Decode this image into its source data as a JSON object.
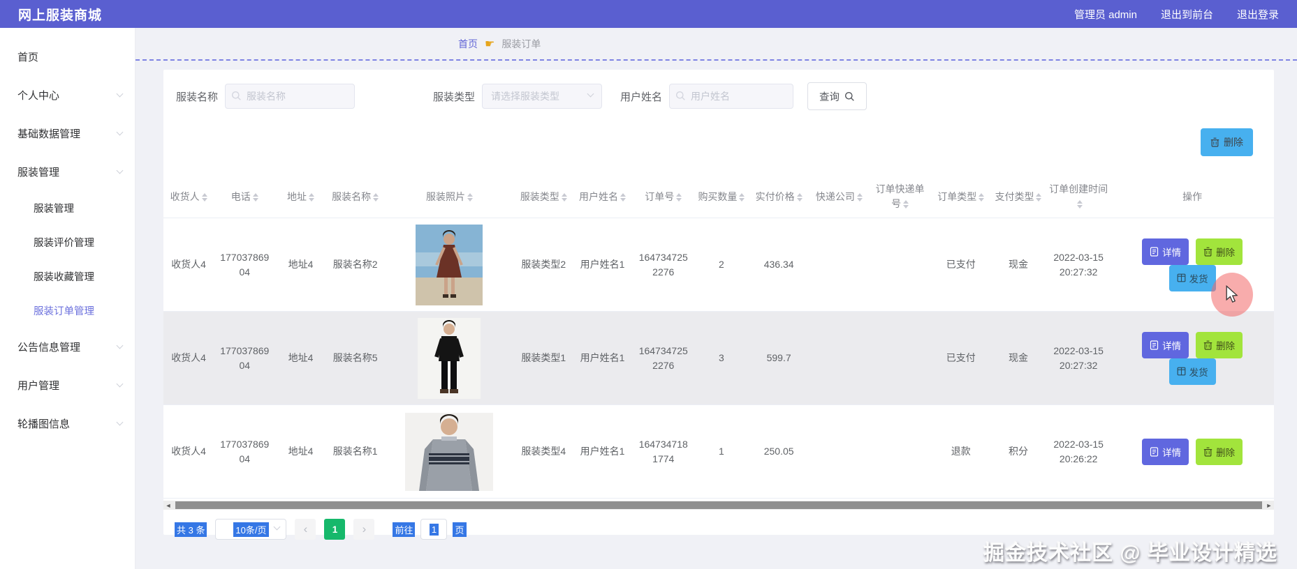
{
  "header": {
    "brand": "网上服装商城",
    "admin_label": "管理员 admin",
    "exit_front": "退出到前台",
    "logout": "退出登录"
  },
  "sidebar": {
    "items": [
      {
        "label": "首页",
        "type": "top",
        "arrow": false,
        "active": false
      },
      {
        "label": "个人中心",
        "type": "top",
        "arrow": true,
        "active": false
      },
      {
        "label": "基础数据管理",
        "type": "top",
        "arrow": true,
        "active": false
      },
      {
        "label": "服装管理",
        "type": "top",
        "arrow": true,
        "active": false
      },
      {
        "label": "服装管理",
        "type": "sub",
        "arrow": false,
        "active": false
      },
      {
        "label": "服装评价管理",
        "type": "sub",
        "arrow": false,
        "active": false
      },
      {
        "label": "服装收藏管理",
        "type": "sub",
        "arrow": false,
        "active": false
      },
      {
        "label": "服装订单管理",
        "type": "sub",
        "arrow": false,
        "active": true
      },
      {
        "label": "公告信息管理",
        "type": "top",
        "arrow": true,
        "active": false
      },
      {
        "label": "用户管理",
        "type": "top",
        "arrow": true,
        "active": false
      },
      {
        "label": "轮播图信息",
        "type": "top",
        "arrow": true,
        "active": false
      }
    ]
  },
  "breadcrumb": {
    "home": "首页",
    "current": "服装订单"
  },
  "filters": {
    "name_label": "服装名称",
    "name_placeholder": "服装名称",
    "type_label": "服装类型",
    "type_placeholder": "请选择服装类型",
    "user_label": "用户姓名",
    "user_placeholder": "用户姓名",
    "query_label": "查询"
  },
  "toolbar": {
    "delete_label": "删除"
  },
  "table": {
    "headers": [
      {
        "key": "consignee",
        "label": "收货人",
        "sortable": true
      },
      {
        "key": "phone",
        "label": "电话",
        "sortable": true
      },
      {
        "key": "address",
        "label": "地址",
        "sortable": true
      },
      {
        "key": "clothes_name",
        "label": "服装名称",
        "sortable": true
      },
      {
        "key": "photo",
        "label": "服装照片",
        "sortable": true
      },
      {
        "key": "clothes_type",
        "label": "服装类型",
        "sortable": true
      },
      {
        "key": "user_name",
        "label": "用户姓名",
        "sortable": true
      },
      {
        "key": "order_no",
        "label": "订单号",
        "sortable": true
      },
      {
        "key": "quantity",
        "label": "购买数量",
        "sortable": true
      },
      {
        "key": "price",
        "label": "实付价格",
        "sortable": true
      },
      {
        "key": "courier",
        "label": "快递公司",
        "sortable": true
      },
      {
        "key": "tracking_no",
        "label": "订单快递单号",
        "sortable": true
      },
      {
        "key": "order_type",
        "label": "订单类型",
        "sortable": true
      },
      {
        "key": "pay_type",
        "label": "支付类型",
        "sortable": true
      },
      {
        "key": "created",
        "label": "订单创建时间",
        "sortable": true
      },
      {
        "key": "actions",
        "label": "操作",
        "sortable": false
      }
    ],
    "action_labels": {
      "detail": "详情",
      "remove": "删除",
      "ship": "发货"
    },
    "rows": [
      {
        "consignee": "收货人4",
        "phone": "17703786904",
        "address": "地址4",
        "clothes_name": "服装名称2",
        "photo": "woman-dark-red-dress-outdoor",
        "clothes_type": "服装类型2",
        "user_name": "用户姓名1",
        "order_no": "1647347252276",
        "quantity": "2",
        "price": "436.34",
        "courier": "",
        "tracking_no": "",
        "order_type": "已支付",
        "pay_type": "现金",
        "created": "2022-03-15 20:27:32",
        "actions": [
          "detail",
          "remove",
          "ship"
        ]
      },
      {
        "consignee": "收货人4",
        "phone": "17703786904",
        "address": "地址4",
        "clothes_name": "服装名称5",
        "photo": "man-black-outfit",
        "clothes_type": "服装类型1",
        "user_name": "用户姓名1",
        "order_no": "1647347252276",
        "quantity": "3",
        "price": "599.7",
        "courier": "",
        "tracking_no": "",
        "order_type": "已支付",
        "pay_type": "现金",
        "created": "2022-03-15 20:27:32",
        "actions": [
          "detail",
          "remove",
          "ship"
        ]
      },
      {
        "consignee": "收货人4",
        "phone": "17703786904",
        "address": "地址4",
        "clothes_name": "服装名称1",
        "photo": "man-gray-striped-sweater",
        "clothes_type": "服装类型4",
        "user_name": "用户姓名1",
        "order_no": "1647347181774",
        "quantity": "1",
        "price": "250.05",
        "courier": "",
        "tracking_no": "",
        "order_type": "退款",
        "pay_type": "积分",
        "created": "2022-03-15 20:26:22",
        "actions": [
          "detail",
          "remove"
        ]
      }
    ]
  },
  "pagination": {
    "total": "共 3 条",
    "page_size": "10条/页",
    "prev": "‹",
    "current_page": "1",
    "next": "›",
    "goto_label": "前往",
    "goto_value": "1",
    "page_unit": "页"
  },
  "watermark": "掘金技术社区 @ 毕业设计精选",
  "colors": {
    "header_bg": "#5a5fd0",
    "active_menu": "#6c71dd",
    "breadcrumb_link": "#6266d6",
    "dashed_line": "#7d82e3",
    "detail_button": "#6067df",
    "remove_button": "#a2e43c",
    "ship_button": "#47b0ef",
    "page_active": "#16b86b",
    "selection_highlight": "#3577e5"
  }
}
